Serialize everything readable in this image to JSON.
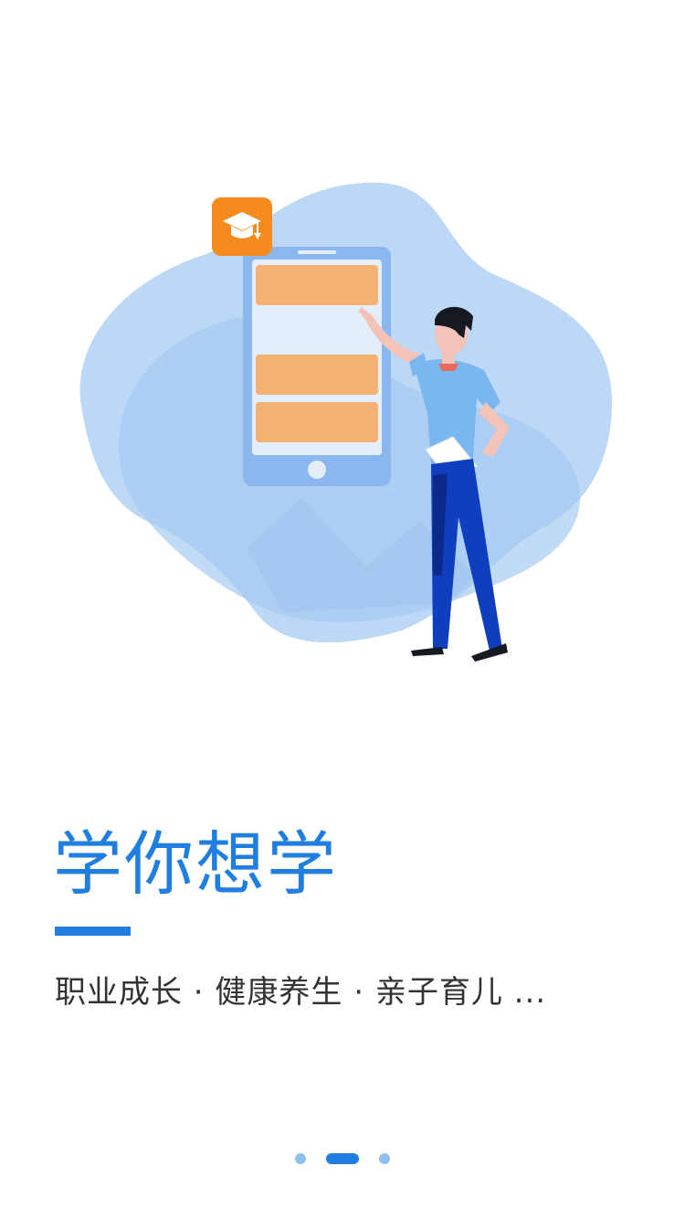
{
  "onboarding": {
    "headline": "学你想学",
    "subtitle": "职业成长 · 健康养生 · 亲子育儿 ...",
    "page_indicator": {
      "count": 3,
      "active_index": 1
    }
  },
  "illustration": {
    "icon": "graduation-cap-icon",
    "accent_color": "#1f7ee0",
    "blob_color": "#b9d6f5",
    "card_color": "#f3b173"
  }
}
